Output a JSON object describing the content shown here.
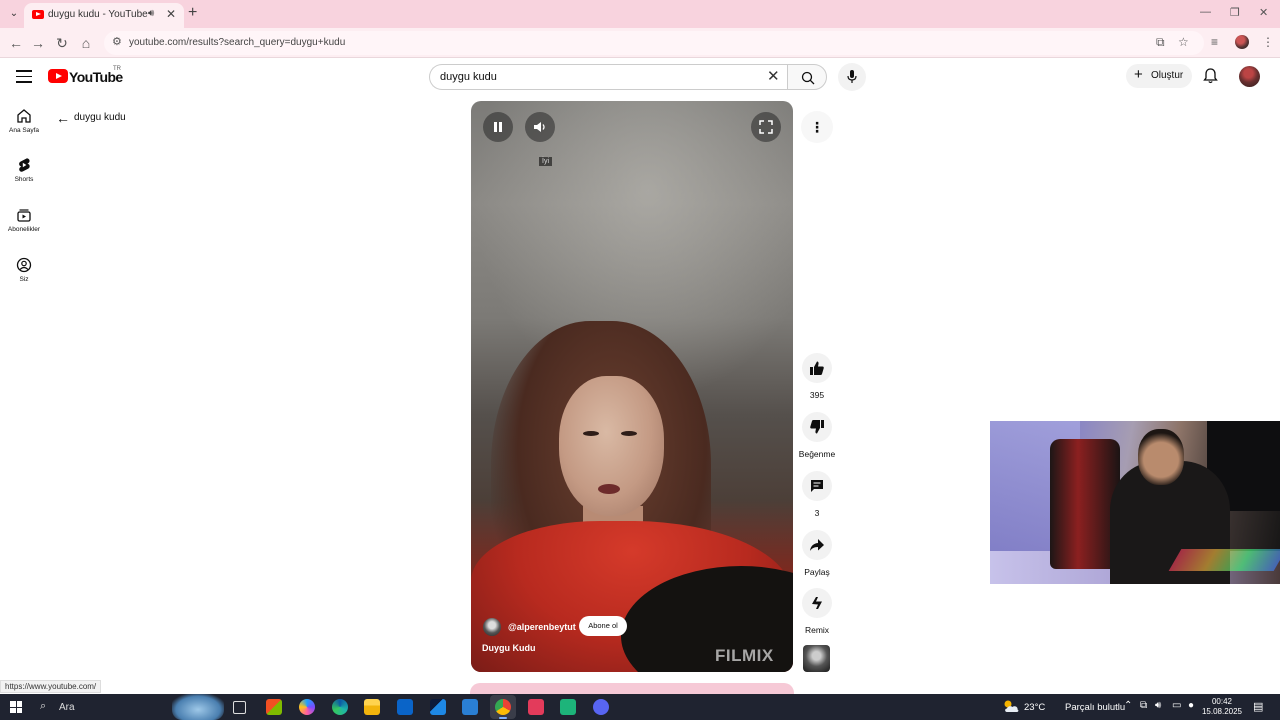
{
  "browser": {
    "tab_title": "duygu kudu - YouTube",
    "url": "youtube.com/results?search_query=duygu+kudu",
    "status_url": "https://www.youtube.com/",
    "theme_color": "#f8d3de"
  },
  "youtube": {
    "logo_text": "YouTube",
    "country_code": "TR",
    "search_query": "duygu kudu",
    "create_label": "Oluştur"
  },
  "guide": {
    "items": [
      {
        "label": "Ana Sayfa",
        "icon": "home-icon"
      },
      {
        "label": "Shorts",
        "icon": "shorts-icon"
      },
      {
        "label": "Abonelikler",
        "icon": "subscriptions-icon"
      },
      {
        "label": "Siz",
        "icon": "user-icon"
      }
    ]
  },
  "results_header": {
    "query_label": "duygu kudu"
  },
  "short": {
    "caption_chip": "İyi",
    "channel_handle": "@alperenbeytut",
    "subscribe_label": "Abone ol",
    "title": "Duygu Kudu",
    "watermark": "FILMIX"
  },
  "actions": {
    "like_count": "395",
    "dislike_label": "Beğenme",
    "comment_count": "3",
    "share_label": "Paylaş",
    "remix_label": "Remix"
  },
  "taskbar": {
    "search_placeholder": "Ara",
    "weather_temp": "23°C",
    "weather_desc": "Parçalı bulutlu",
    "time": "00:42",
    "date": "15.08.2025"
  }
}
